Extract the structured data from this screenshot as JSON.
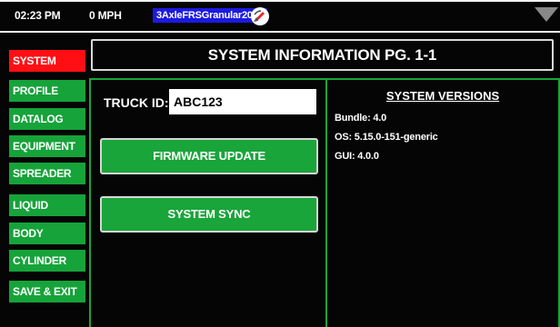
{
  "status_bar": {
    "time": "02:23 PM",
    "speed": "0 MPH",
    "config_name": "3AxleFRSGranular2020",
    "gps_icon": "satellite-dish-icon",
    "menu_icon": "triangle-down-icon"
  },
  "sidebar": {
    "items": [
      {
        "label": "SYSTEM",
        "active": true
      },
      {
        "label": "PROFILE"
      },
      {
        "label": "DATALOG"
      },
      {
        "label": "EQUIPMENT"
      },
      {
        "label": "SPREADER"
      },
      {
        "label": "LIQUID"
      },
      {
        "label": "BODY"
      },
      {
        "label": "CYLINDER"
      },
      {
        "label": "SAVE & EXIT"
      }
    ]
  },
  "main": {
    "title": "SYSTEM INFORMATION PG. 1-1",
    "truck_id_label": "TRUCK ID:",
    "truck_id_value": "ABC123",
    "firmware_button": "FIRMWARE UPDATE",
    "sync_button": "SYSTEM SYNC",
    "versions": {
      "heading": "SYSTEM VERSIONS",
      "bundle": "Bundle: 4.0",
      "os": "OS: 5.15.0-151-generic",
      "gui": "GUI: 4.0.0"
    }
  },
  "colors": {
    "active_nav": "#ff0f14",
    "nav": "#16a33a",
    "config_badge": "#1c1ae0",
    "panel_border": "#19a53a"
  }
}
